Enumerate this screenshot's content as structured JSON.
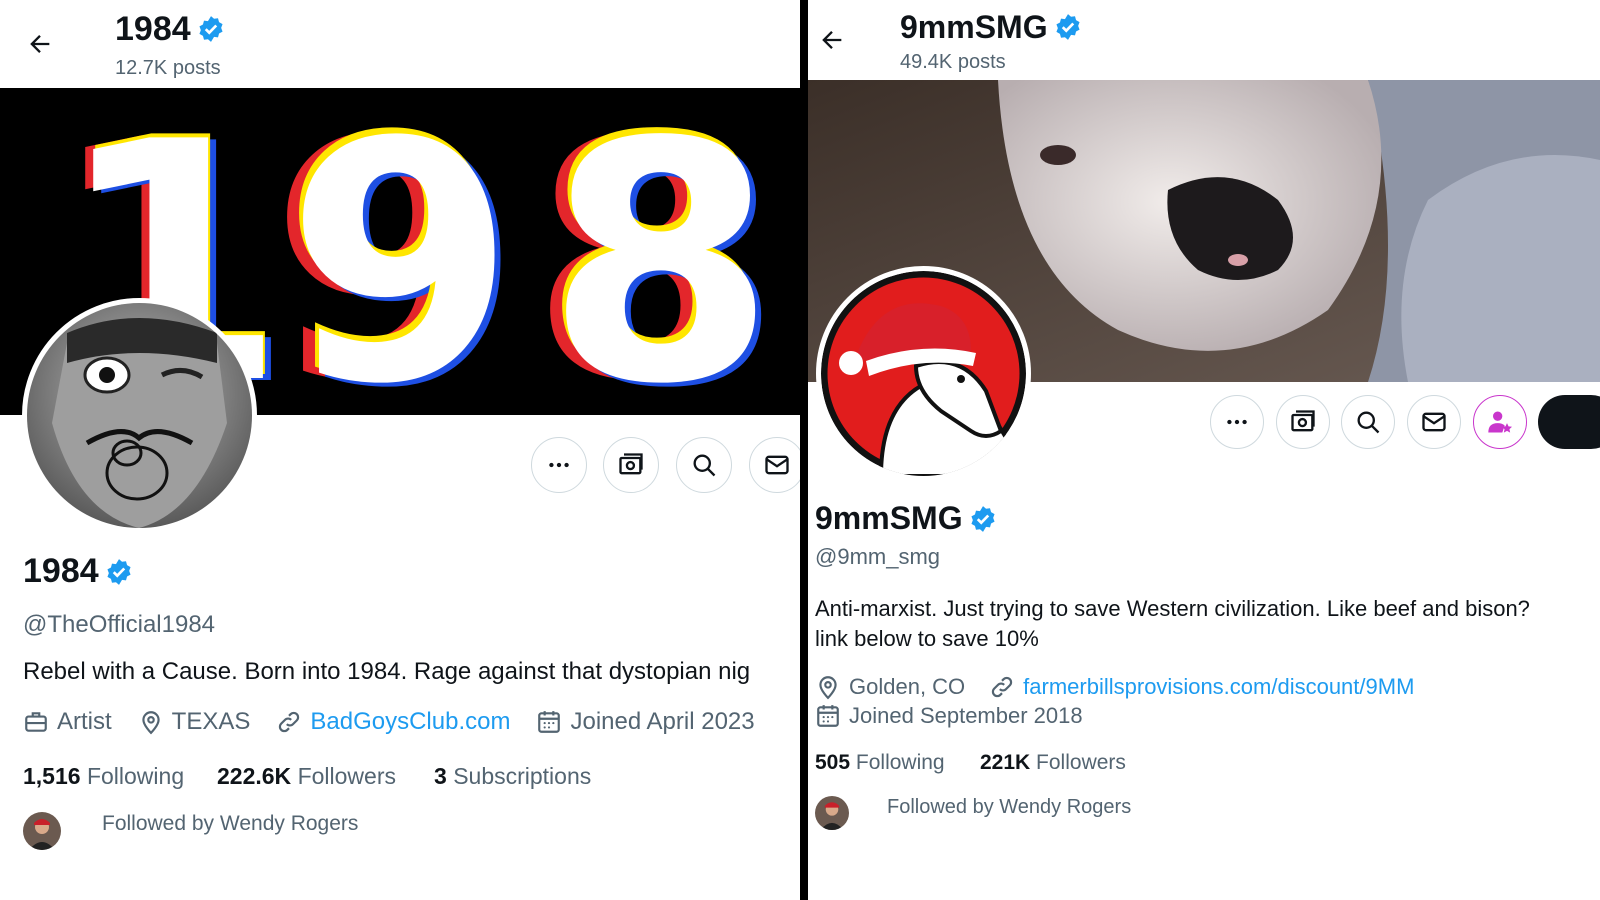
{
  "left": {
    "header": {
      "title": "1984",
      "posts": "12.7K posts"
    },
    "banner": {
      "text": "198"
    },
    "name": "1984",
    "handle": "@TheOfficial1984",
    "bio": "Rebel with a Cause. Born into 1984. Rage against that dystopian nig",
    "meta": {
      "occupation": "Artist",
      "location": "TEXAS",
      "link": "BadGoysClub.com",
      "joined": "Joined April 2023"
    },
    "stats": {
      "following_count": "1,516",
      "following_label": "Following",
      "followers_count": "222.6K",
      "followers_label": "Followers",
      "subs_count": "3",
      "subs_label": "Subscriptions"
    },
    "followed_by": "Followed by Wendy Rogers"
  },
  "right": {
    "header": {
      "title": "9mmSMG",
      "posts": "49.4K posts"
    },
    "name": "9mmSMG",
    "handle": "@9mm_smg",
    "bio_line1": "Anti-marxist. Just trying to save Western civilization. Like beef and bison?",
    "bio_line2": "link below to save 10%",
    "meta": {
      "location": "Golden, CO",
      "link": "farmerbillsprovisions.com/discount/9MM",
      "joined": "Joined September 2018"
    },
    "stats": {
      "following_count": "505",
      "following_label": "Following",
      "followers_count": "221K",
      "followers_label": "Followers"
    },
    "followed_by": "Followed by Wendy Rogers"
  },
  "colors": {
    "accent": "#1d9bf0",
    "secondary_text": "#536471",
    "border": "#cfd9de",
    "subscribe_pink": "#c936cc"
  }
}
